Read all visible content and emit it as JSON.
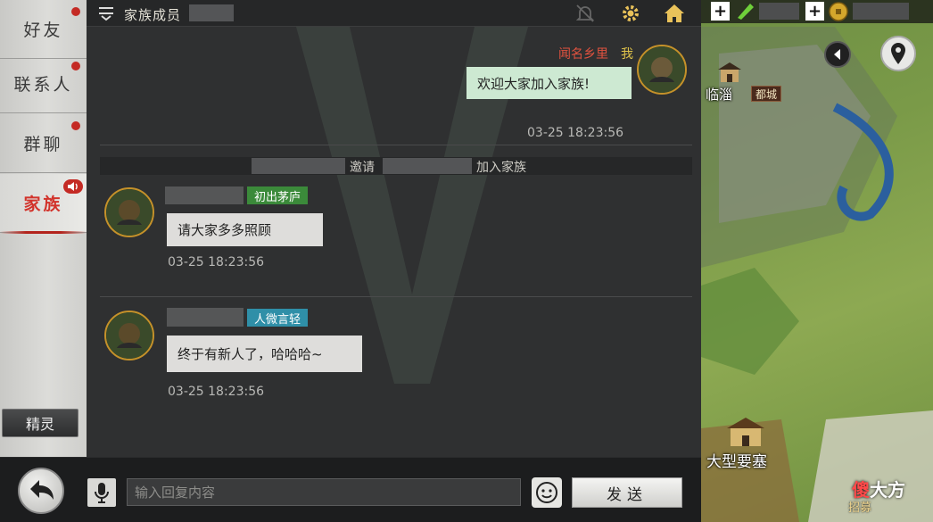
{
  "sidebar": {
    "items": [
      {
        "label": "好友",
        "has_dot": true
      },
      {
        "label": "联系人",
        "has_dot": true
      },
      {
        "label": "群聊",
        "has_dot": true
      },
      {
        "label": "家族",
        "active": true,
        "speaker_icon": "speaker-icon"
      }
    ],
    "spirit_label": "精灵"
  },
  "header": {
    "title": "家族成员",
    "icons": [
      "menu-icon",
      "bell-muted-icon",
      "gear-icon",
      "home-icon"
    ]
  },
  "messages": {
    "self": {
      "title_tag": "闻名乡里",
      "me_label": "我",
      "text": "欢迎大家加入家族!",
      "time": "03-25 18:23:56"
    },
    "system": {
      "invite_word": "邀请",
      "join_text": "加入家族"
    },
    "first": {
      "tag": "初出茅庐",
      "text": "请大家多多照顾",
      "time": "03-25 18:23:56"
    },
    "second": {
      "tag": "人微言轻",
      "text": "终于有新人了，哈哈哈~",
      "time": "03-25 18:23:56"
    }
  },
  "input": {
    "placeholder": "输入回复内容",
    "send_label": "发送"
  },
  "map": {
    "city_name": "临淄",
    "city_badge": "都城",
    "fortress_name": "大型要塞",
    "brand_a": "傻",
    "brand_b": "大方",
    "recruit": "招募"
  },
  "colors": {
    "accent_red": "#c42a24",
    "bubble_self": "#cde9d2",
    "bubble_other": "#dedddb",
    "tag_green": "#3b8a3a",
    "tag_teal": "#2f8fa8"
  }
}
